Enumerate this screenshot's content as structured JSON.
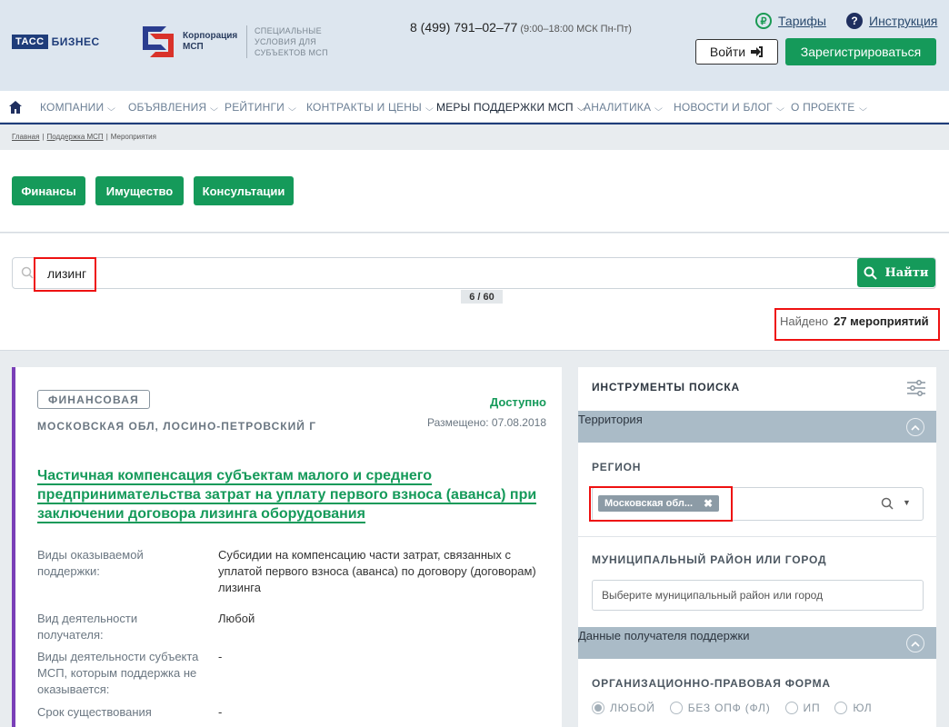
{
  "header": {
    "tass_box": "ТАСС",
    "tass_word": "БИЗНЕС",
    "corp_name": "Корпорация МСП",
    "corp_sub": "СПЕЦИАЛЬНЫЕ УСЛОВИЯ ДЛЯ СУБЪЕКТОВ МСП",
    "phone": "8 (499) 791–02–77",
    "hours": "(9:00–18:00 МСК Пн-Пт)",
    "tariffs": "Тарифы",
    "instructions": "Инструкция",
    "login": "Войти",
    "register": "Зарегистрироваться"
  },
  "nav": {
    "items": [
      "КОМПАНИИ",
      "ОБЪЯВЛЕНИЯ",
      "РЕЙТИНГИ",
      "КОНТРАКТЫ И ЦЕНЫ",
      "МЕРЫ ПОДДЕРЖКИ МСП",
      "АНАЛИТИКА",
      "НОВОСТИ И БЛОГ",
      "О ПРОЕКТЕ"
    ],
    "active_index": 4
  },
  "breadcrumb": {
    "items": [
      "Главная",
      "Поддержка МСП",
      "Мероприятия"
    ]
  },
  "categories": [
    "Финансы",
    "Имущество",
    "Консультации"
  ],
  "search": {
    "value": "лизинг",
    "button": "Найти",
    "counter": "6 / 60",
    "found_label": "Найдено",
    "found_count": "27 мероприятий"
  },
  "card": {
    "tag": "ФИНАНСОВАЯ",
    "status": "Доступно",
    "location": "МОСКОВСКАЯ ОБЛ, ЛОСИНО-ПЕТРОВСКИЙ Г",
    "posted": "Размещено: 07.08.2018",
    "title": "Частичная компенсация субъектам малого и среднего предпринимательства затрат на уплату первого взноса (аванса) при заключении договора лизинга оборудования",
    "rows": [
      {
        "k": "Виды оказываемой поддержки:",
        "v": "Субсидии на компенсацию части затрат, связанных с уплатой первого взноса (аванса) по договору (договорам) лизинга"
      },
      {
        "k": "Вид деятельности получателя:",
        "v": "Любой"
      },
      {
        "k": "Виды деятельности субъекта МСП, которым поддержка не оказывается:",
        "v": "-"
      },
      {
        "k": "Срок существования",
        "v": "-"
      }
    ]
  },
  "tools": {
    "title": "ИНСТРУМЕНТЫ ПОИСКА",
    "territory": "Территория",
    "region_label": "РЕГИОН",
    "region_chip": "Московская обл...",
    "muni_label": "МУНИЦИПАЛЬНЫЙ РАЙОН ИЛИ ГОРОД",
    "muni_placeholder": "Выберите муниципальный район или город",
    "recipient": "Данные получателя поддержки",
    "legal_form_label": "ОРГАНИЗАЦИОННО-ПРАВОВАЯ ФОРМА",
    "legal_forms": [
      "ЛЮБОЙ",
      "БЕЗ ОПФ (ФЛ)",
      "ИП",
      "ЮЛ"
    ],
    "legal_selected": 0
  },
  "colors": {
    "accent_green": "#159a5a",
    "header_bg": "#dde6ef",
    "card_accent": "#7a3fb8",
    "highlight": "#e11111"
  }
}
